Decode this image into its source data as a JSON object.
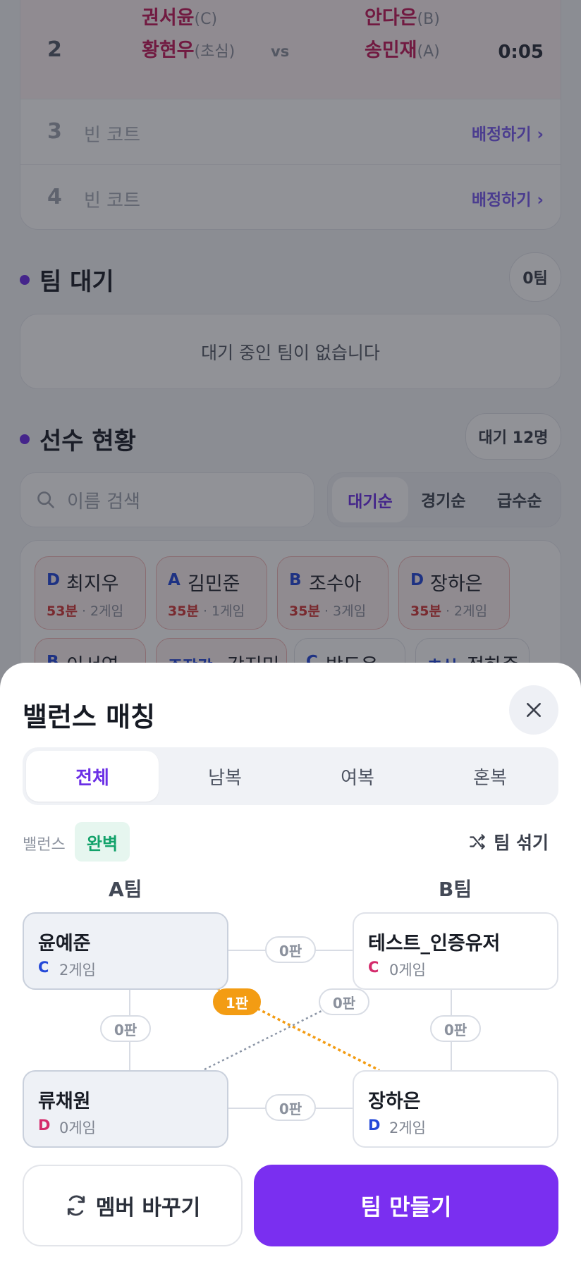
{
  "courts": [
    {
      "num": "2",
      "team_a": [
        {
          "name": "권서윤",
          "level": "(C)"
        },
        {
          "name": "황현우",
          "level": "(초심)"
        }
      ],
      "vs": "vs",
      "team_b": [
        {
          "name": "안다은",
          "level": "(B)"
        },
        {
          "name": "송민재",
          "level": "(A)"
        }
      ],
      "time": "0:05"
    },
    {
      "num": "3",
      "empty": "빈 코트",
      "assign": "배정하기 ›"
    },
    {
      "num": "4",
      "empty": "빈 코트",
      "assign": "배정하기 ›"
    }
  ],
  "team_wait": {
    "title": "팀 대기",
    "count": "0팀",
    "empty": "대기 중인 팀이 없습니다"
  },
  "player_status": {
    "title": "선수 현황",
    "count": "대기 12명",
    "search_placeholder": "이름 검색",
    "sort": [
      "대기순",
      "경기순",
      "급수순"
    ],
    "players": [
      {
        "level": "D",
        "name": "최지우",
        "wait": "53분",
        "games": "2게임"
      },
      {
        "level": "A",
        "name": "김민준",
        "wait": "35분",
        "games": "1게임"
      },
      {
        "level": "B",
        "name": "조수아",
        "wait": "35분",
        "games": "3게임"
      },
      {
        "level": "D",
        "name": "장하은",
        "wait": "35분",
        "games": "2게임"
      },
      {
        "level": "B",
        "name": "이서연"
      },
      {
        "level": "주작각",
        "name": "강지민"
      },
      {
        "level": "C",
        "name": "박도윤"
      },
      {
        "level": "초심",
        "name": "정하준"
      }
    ]
  },
  "sheet": {
    "title": "밸런스 매칭",
    "tabs": [
      "전체",
      "남복",
      "여복",
      "혼복"
    ],
    "balance_label": "밸런스",
    "balance_value": "완벽",
    "shuffle_label": "팀 섞기",
    "team_a_label": "A팀",
    "team_b_label": "B팀",
    "players": [
      {
        "name": "윤예준",
        "level": "C",
        "games": "2게임"
      },
      {
        "name": "테스트_인증유저",
        "level": "C",
        "games": "0게임"
      },
      {
        "name": "류채원",
        "level": "D",
        "games": "0게임"
      },
      {
        "name": "장하은",
        "level": "D",
        "games": "2게임"
      }
    ],
    "edges": [
      "0판",
      "0판",
      "0판",
      "0판",
      "1판",
      "0판"
    ],
    "swap_button": "멤버 바꾸기",
    "make_button": "팀 만들기"
  },
  "colors": {
    "accent": "#7a2ff0",
    "perfect": "#12a26a",
    "hot_edge": "#f39c13",
    "level_c": "#2348d8",
    "level_d": "#d42a6b"
  }
}
